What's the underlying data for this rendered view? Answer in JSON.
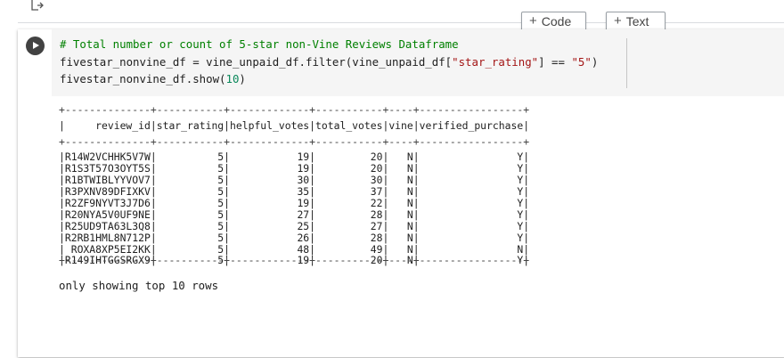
{
  "toolbar": {
    "add_code_label": "Code",
    "add_text_label": "Text"
  },
  "code_cell": {
    "lines": [
      "# Total number or count of 5-star non-Vine Reviews Dataframe",
      "fivestar_nonvine_df = vine_unpaid_df.filter(vine_unpaid_df[\"star_rating\"] == \"5\")",
      "fivestar_nonvine_df.show(10)"
    ]
  },
  "output": {
    "table": {
      "columns": [
        "review_id",
        "star_rating",
        "helpful_votes",
        "total_votes",
        "vine",
        "verified_purchase"
      ],
      "rows": [
        [
          "R14W2VCHHK5V7W",
          "5",
          "19",
          "20",
          "N",
          "Y"
        ],
        [
          "R1S3T57O3OYT5S",
          "5",
          "19",
          "20",
          "N",
          "Y"
        ],
        [
          "R1BTWIBLYYVOV7",
          "5",
          "30",
          "30",
          "N",
          "Y"
        ],
        [
          "R3PXNV89DFIXKV",
          "5",
          "35",
          "37",
          "N",
          "Y"
        ],
        [
          "R2ZF9NYVT3J7D6",
          "5",
          "19",
          "22",
          "N",
          "Y"
        ],
        [
          "R20NYA5V0UF9NE",
          "5",
          "27",
          "28",
          "N",
          "Y"
        ],
        [
          "R25UD9TA63L3Q8",
          "5",
          "25",
          "27",
          "N",
          "Y"
        ],
        [
          "R2RB1HML8N712P",
          "5",
          "26",
          "28",
          "N",
          "Y"
        ],
        [
          " ROXA8XP5EI2KK",
          "5",
          "48",
          "49",
          "N",
          "N"
        ],
        [
          "R149IHTGGSRGX9",
          "5",
          "19",
          "20",
          "N",
          "Y"
        ]
      ]
    },
    "footer": "only showing top 10 rows"
  }
}
